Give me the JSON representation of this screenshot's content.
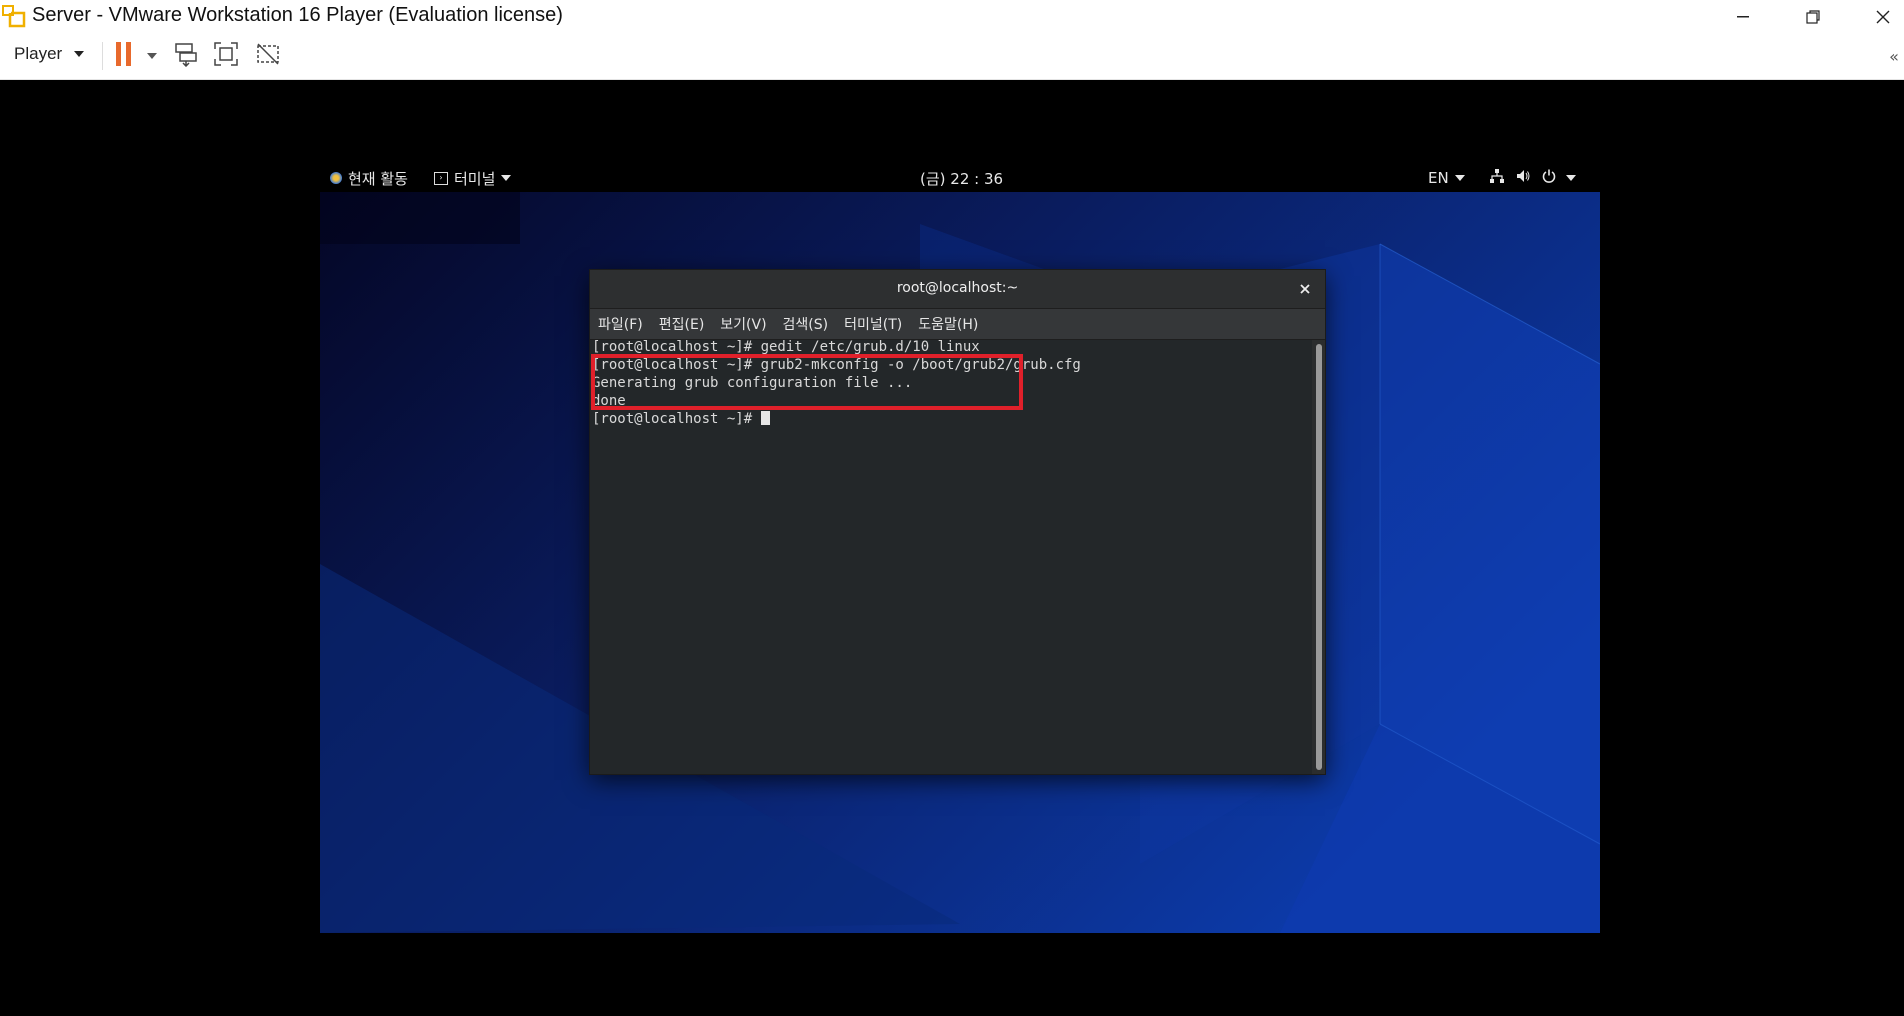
{
  "window": {
    "title": "Server - VMware Workstation 16 Player (Evaluation license)"
  },
  "toolbar": {
    "player_label": "Player",
    "icons": [
      "pause-icon",
      "send-keys-icon",
      "fullscreen-icon",
      "unity-icon",
      "collapse-icon"
    ]
  },
  "guest": {
    "topbar": {
      "activities": "현재 활동",
      "app_menu": "터미널",
      "clock": "(금) 22 : 36",
      "input_method": "EN"
    },
    "terminal": {
      "title": "root@localhost:~",
      "menu": [
        "파일(F)",
        "편집(E)",
        "보기(V)",
        "검색(S)",
        "터미널(T)",
        "도움말(H)"
      ],
      "lines": [
        "[root@localhost ~]# gedit /etc/grub.d/10_linux",
        "[root@localhost ~]# grub2-mkconfig -o /boot/grub2/grub.cfg",
        "Generating grub configuration file ...",
        "done",
        "[root@localhost ~]# "
      ]
    }
  },
  "colors": {
    "highlight": "#e0202a",
    "pause_accent": "#e8692c"
  }
}
